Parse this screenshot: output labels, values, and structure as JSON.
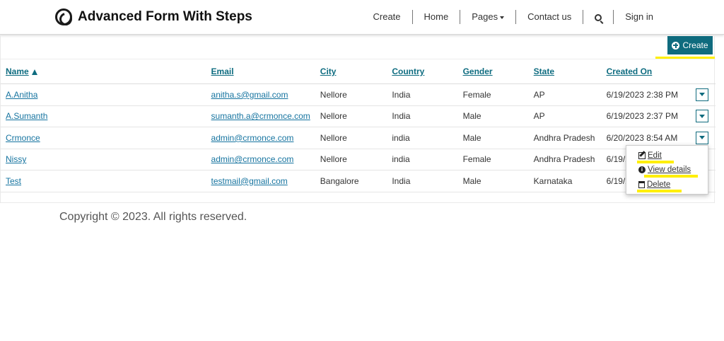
{
  "brand": {
    "title": "Advanced Form With Steps"
  },
  "nav": {
    "items": [
      {
        "label": "Create"
      },
      {
        "label": "Home"
      },
      {
        "label": "Pages"
      },
      {
        "label": "Contact us"
      },
      {
        "label": ""
      },
      {
        "label": "Sign in"
      }
    ]
  },
  "toolbar": {
    "create_label": "Create"
  },
  "table": {
    "columns": [
      "Name",
      "Email",
      "City",
      "Country",
      "Gender",
      "State",
      "Created On"
    ],
    "sort": {
      "column": "Name",
      "direction": "ascending"
    },
    "rows": [
      {
        "name": "A.Anitha",
        "email": "anitha.s@gmail.com",
        "city": "Nellore",
        "country": "India",
        "gender": "Female",
        "state": "AP",
        "created": "6/19/2023 2:38 PM"
      },
      {
        "name": "A.Sumanth",
        "email": "sumanth.a@crmonce.com",
        "city": "Nellore",
        "country": "India",
        "gender": "Male",
        "state": "AP",
        "created": "6/19/2023 2:37 PM"
      },
      {
        "name": "Crmonce",
        "email": "admin@crmonce.com",
        "city": "Nellore",
        "country": "india",
        "gender": "Male",
        "state": "Andhra Pradesh",
        "created": "6/20/2023 8:54 AM"
      },
      {
        "name": "Nissy",
        "email": "admin@crmonce.com",
        "city": "Nellore",
        "country": "india",
        "gender": "Female",
        "state": "Andhra Pradesh",
        "created": "6/19/2"
      },
      {
        "name": "Test",
        "email": "testmail@gmail.com",
        "city": "Bangalore",
        "country": "India",
        "gender": "Male",
        "state": "Karnataka",
        "created": "6/19/2"
      }
    ]
  },
  "menu": {
    "edit_label": "Edit",
    "view_label": "View details",
    "delete_label": "Delete"
  },
  "colors": {
    "accent": "#0f6b7e",
    "link": "#1674a0",
    "highlight": "#ffef00"
  },
  "footer": {
    "copyright": "Copyright © 2023. All rights reserved."
  }
}
